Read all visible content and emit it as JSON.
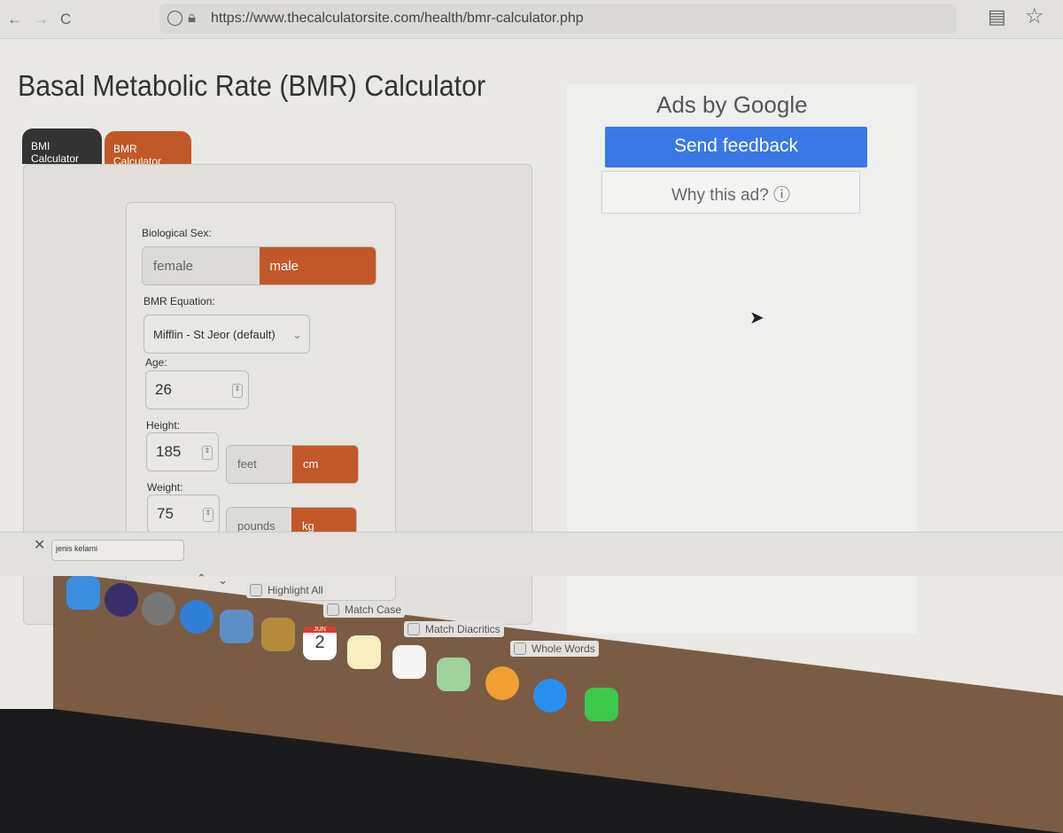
{
  "browser": {
    "url": "https://www.thecalculatorsite.com/health/bmr-calculator.php",
    "back": "←",
    "forward": "→",
    "reload": "C"
  },
  "page": {
    "title": "Basal Metabolic Rate (BMR) Calculator",
    "back_arrow": "←"
  },
  "tabs": [
    {
      "label": "BMI Calculator",
      "active": false
    },
    {
      "label": "BMR Calculator",
      "active": true
    }
  ],
  "form": {
    "sex_label": "Biological Sex:",
    "sex_options": [
      "female",
      "male"
    ],
    "sex_selected": "male",
    "equation_label": "BMR Equation:",
    "equation_value": "Mifflin - St Jeor (default)",
    "age_label": "Age:",
    "age_value": "26",
    "height_label": "Height:",
    "height_value": "185",
    "height_units": [
      "feet",
      "cm"
    ],
    "height_unit_selected": "cm",
    "weight_label": "Weight:",
    "weight_value": "75",
    "weight_units": [
      "pounds",
      "kg"
    ],
    "weight_unit_selected": "kg"
  },
  "ads": {
    "ads_by": "Ads by Google",
    "send_feedback": "Send feedback",
    "why": "Why this ad? ⓘ"
  },
  "findbar": {
    "query": "jenis kelami",
    "options": [
      "Highlight All",
      "Match Case",
      "Match Diacritics",
      "Whole Words"
    ]
  },
  "dock": {
    "calendar_month": "JUN",
    "calendar_day": "2"
  },
  "colors": {
    "accent": "#c2582a",
    "feedback": "#3b78e7",
    "tab_dark": "#333333"
  }
}
